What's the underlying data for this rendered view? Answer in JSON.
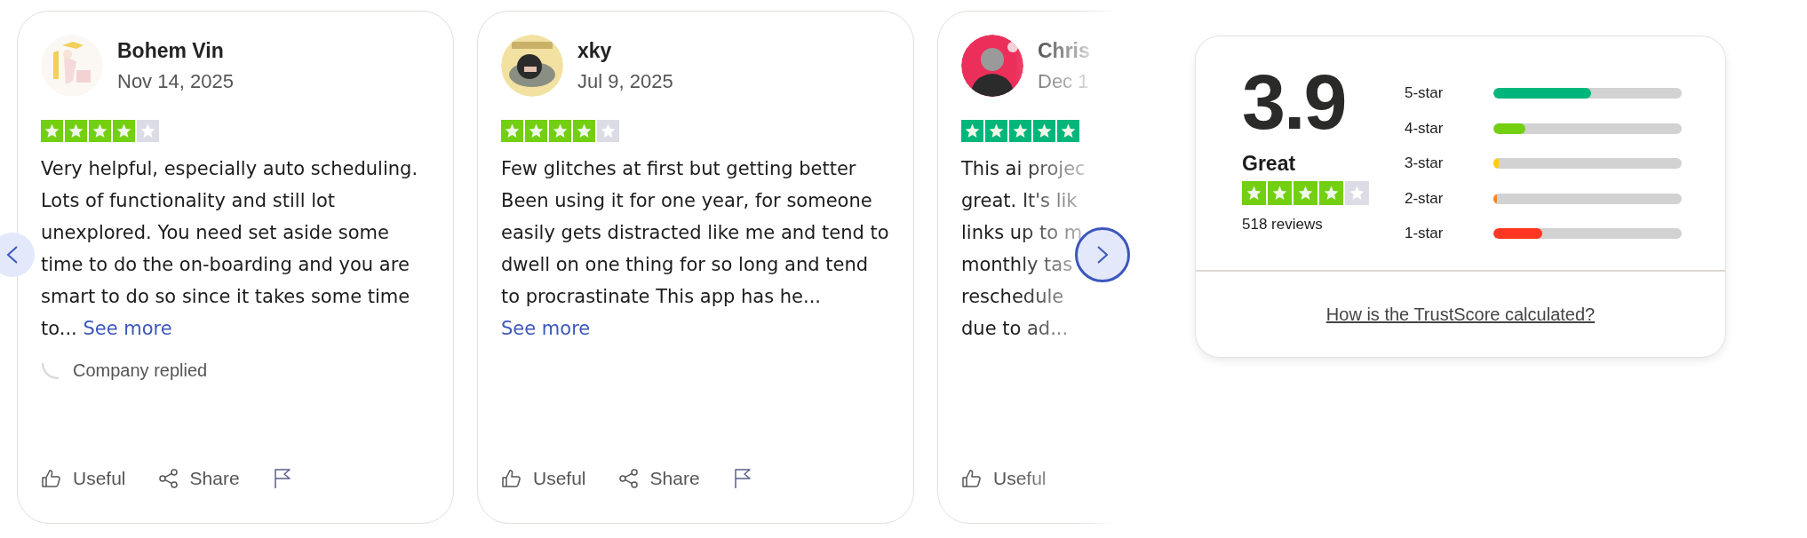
{
  "reviews": [
    {
      "author": "Bohem Vin",
      "date": "Nov 14, 2025",
      "stars": 4,
      "body": "Very helpful, especially auto scheduling. Lots of functionality and still lot unexplored. You need set aside some time to do the on-boarding and you are smart to do so since it takes some time to...",
      "see_more": "See more",
      "reply_note": "Company replied",
      "actions": [
        {
          "kind": "useful",
          "label": "Useful"
        },
        {
          "kind": "share",
          "label": "Share"
        },
        {
          "kind": "report"
        }
      ]
    },
    {
      "author": "xky",
      "date": "Jul 9, 2025",
      "stars": 4,
      "body": "Few glitches at first but getting better Been using it for one year, for someone easily gets distracted like me and tend to dwell on one thing for so long and tend to procrastinate This app has he...",
      "see_more": "See more",
      "actions": [
        {
          "kind": "useful",
          "label": "Useful"
        },
        {
          "kind": "share",
          "label": "Share"
        },
        {
          "kind": "report"
        }
      ]
    },
    {
      "author": "Chris",
      "date": "Dec 1",
      "stars": 5,
      "faded": true,
      "body_lines": [
        "This ai projec",
        "great. It's lik",
        "links up to m",
        "monthly tas",
        "reschedule",
        "due to ad..."
      ],
      "actions": [
        {
          "kind": "useful",
          "label": "Useful"
        }
      ]
    }
  ],
  "summary": {
    "score": "3.9",
    "label": "Great",
    "stars": 4,
    "review_count": "518 reviews",
    "distribution": [
      {
        "label": "5-star",
        "level": 0.52,
        "color": "#00b67a"
      },
      {
        "label": "4-star",
        "level": 0.17,
        "color": "#73cf11"
      },
      {
        "label": "3-star",
        "level": 0.03,
        "color": "#ffce00"
      },
      {
        "label": "2-star",
        "level": 0.02,
        "color": "#ff8622"
      },
      {
        "label": "1-star",
        "level": 0.26,
        "color": "#ff3722"
      }
    ],
    "link": "How is the TrustScore calculated?"
  }
}
